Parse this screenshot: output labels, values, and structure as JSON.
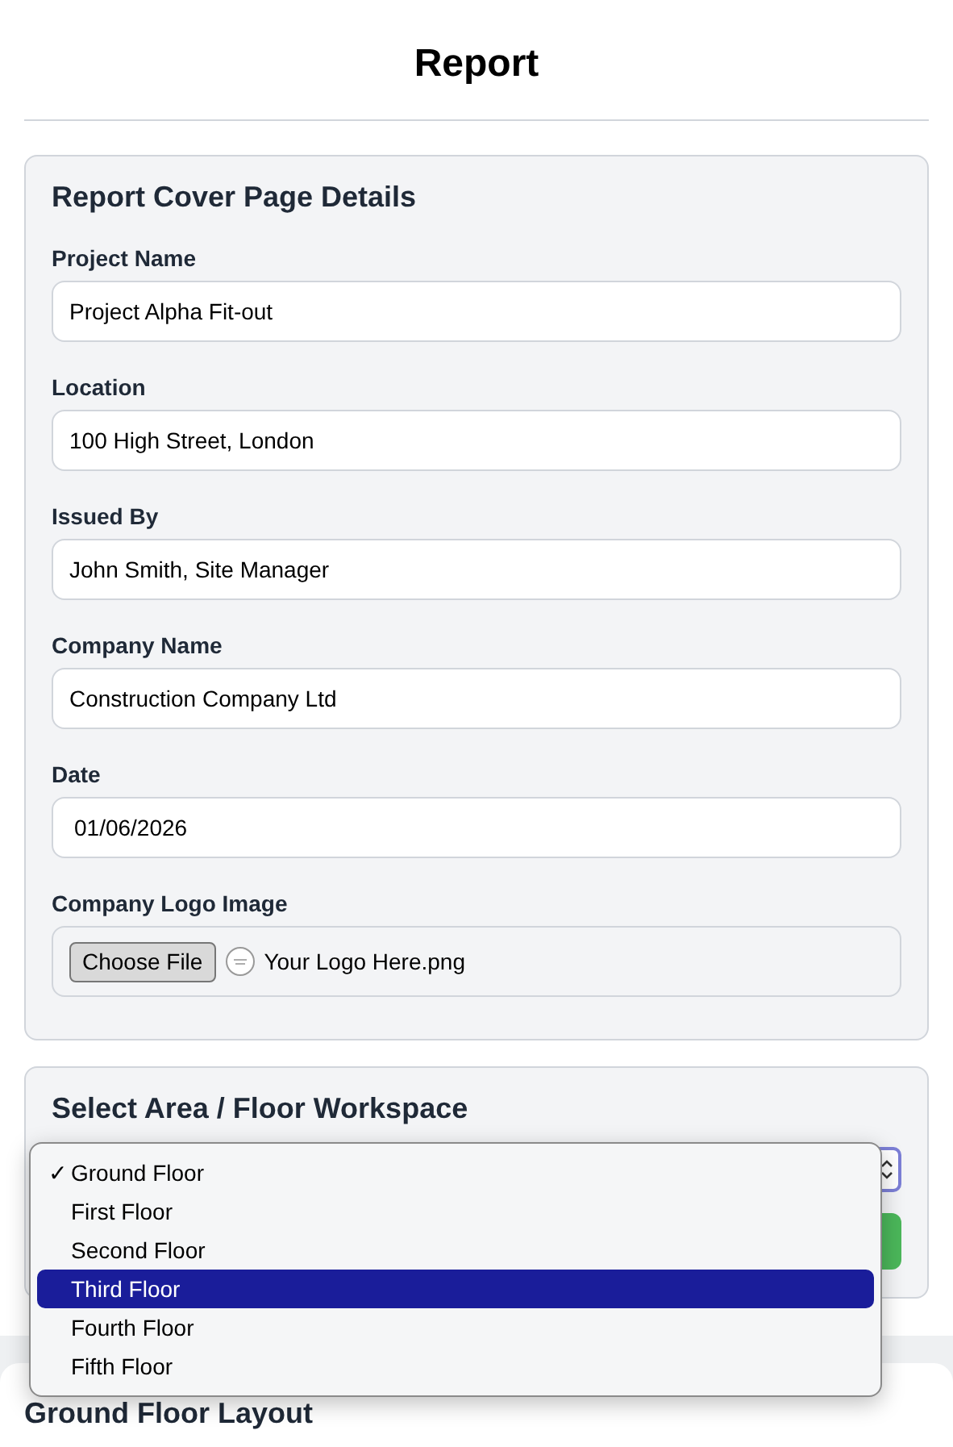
{
  "title": "Report",
  "cover": {
    "heading": "Report Cover Page Details",
    "fields": [
      {
        "label": "Project Name",
        "value": "Project Alpha Fit-out",
        "kind": "text"
      },
      {
        "label": "Location",
        "value": "100 High Street, London",
        "kind": "text"
      },
      {
        "label": "Issued By",
        "value": "John Smith, Site Manager",
        "kind": "text"
      },
      {
        "label": "Company Name",
        "value": "Construction Company Ltd",
        "kind": "text"
      },
      {
        "label": "Date",
        "value": "01/06/2026",
        "kind": "date"
      },
      {
        "label": "Company Logo Image",
        "button": "Choose File",
        "file": "Your Logo Here.png",
        "kind": "file"
      }
    ]
  },
  "workspace": {
    "heading": "Select Area / Floor Workspace",
    "options": [
      {
        "label": "Ground Floor",
        "selected": true,
        "highlighted": false
      },
      {
        "label": "First Floor",
        "selected": false,
        "highlighted": false
      },
      {
        "label": "Second Floor",
        "selected": false,
        "highlighted": false
      },
      {
        "label": "Third Floor",
        "selected": false,
        "highlighted": true
      },
      {
        "label": "Fourth Floor",
        "selected": false,
        "highlighted": false
      },
      {
        "label": "Fifth Floor",
        "selected": false,
        "highlighted": false
      }
    ],
    "check": "✓"
  },
  "layout": {
    "heading": "Ground Floor Layout"
  }
}
